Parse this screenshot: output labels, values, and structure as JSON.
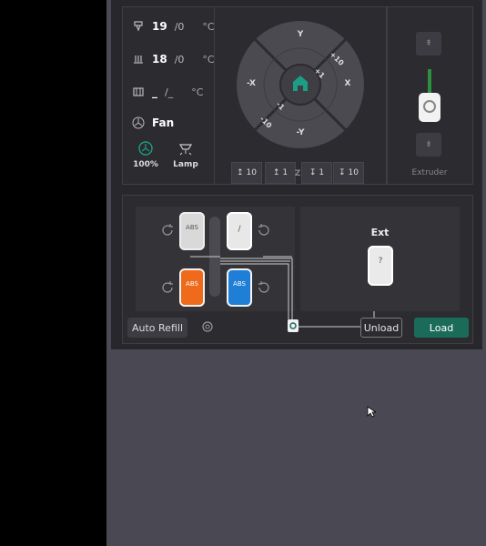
{
  "temps": {
    "nozzle": {
      "current": "19",
      "target": "/0",
      "unit": "°C"
    },
    "bed": {
      "current": "18",
      "target": "/0",
      "unit": "°C"
    },
    "chamber": {
      "current": "_",
      "target": "/_",
      "unit": "°C"
    }
  },
  "fan": {
    "label": "Fan",
    "speed": "100%",
    "lamp": "Lamp"
  },
  "jog": {
    "y_plus": "Y",
    "y_minus": "-Y",
    "x_plus": "X",
    "x_minus": "-X",
    "plus10": "+10",
    "plus1": "+1",
    "minus1": "-1",
    "minus10": "-10",
    "z_label": "Z",
    "z_buttons": [
      "10",
      "1",
      "1",
      "10"
    ]
  },
  "extruder": {
    "label": "Extruder"
  },
  "ams": {
    "slots": [
      {
        "material": "ABS",
        "color": "#d9d9d9",
        "slot": "A1"
      },
      {
        "material": "/",
        "color": "#e8e8e8",
        "slot": "A4"
      },
      {
        "material": "ABS",
        "color": "#ef6a1a",
        "slot": "A2"
      },
      {
        "material": "ABS",
        "color": "#1f7fd6",
        "slot": "A3"
      }
    ],
    "ext_title": "Ext",
    "ext_material": "?",
    "auto_refill": "Auto Refill",
    "unload": "Unload",
    "load": "Load"
  },
  "colors": {
    "accent": "#1b6b5a",
    "panel": "#28282c"
  }
}
